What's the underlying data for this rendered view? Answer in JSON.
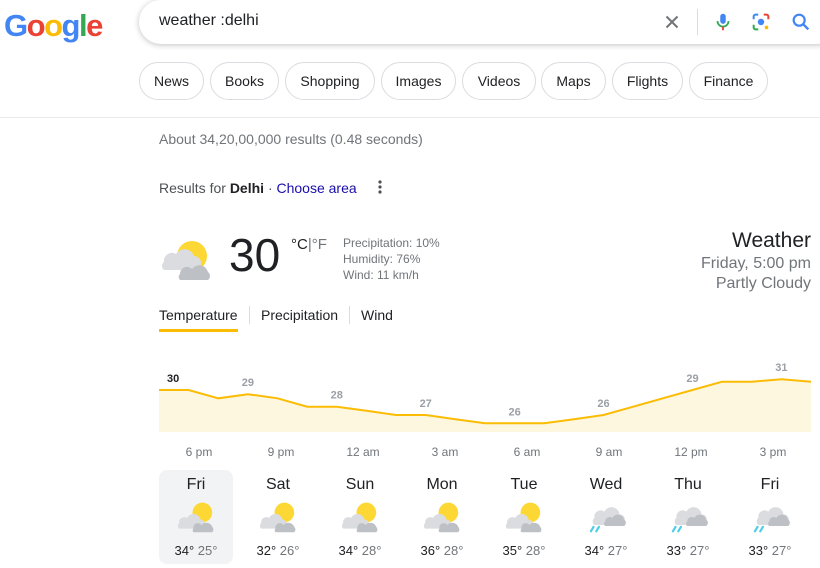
{
  "logo": {
    "text": "Google",
    "letters": [
      "G",
      "o",
      "o",
      "g",
      "l",
      "e"
    ]
  },
  "search": {
    "query": "weather :delhi"
  },
  "chips": [
    "News",
    "Books",
    "Shopping",
    "Images",
    "Videos",
    "Maps",
    "Flights",
    "Finance"
  ],
  "stats": "About 34,20,00,000 results (0.48 seconds)",
  "results_for": {
    "prefix": "Results for",
    "place": "Delhi",
    "separator": "·",
    "change_link": "Choose area"
  },
  "current": {
    "temp": "30",
    "unit_c": "°C",
    "unit_sep": "|",
    "unit_f": "°F",
    "precipitation": "Precipitation: 10%",
    "humidity": "Humidity: 76%",
    "wind": "Wind: 11 km/h",
    "icon": "partly-cloudy-icon"
  },
  "header": {
    "title": "Weather",
    "time": "Friday, 5:00 pm",
    "condition": "Partly Cloudy"
  },
  "tabs": [
    "Temperature",
    "Precipitation",
    "Wind"
  ],
  "colors": {
    "accent": "#fbbc04",
    "chart_fill": "#fef7e0",
    "link": "#1a0dab",
    "rain": "#4ecde6"
  },
  "chart_data": {
    "type": "area",
    "values": [
      30,
      30,
      29,
      29.5,
      29,
      28,
      28,
      27.5,
      27,
      27,
      26.5,
      26,
      26,
      26,
      26.5,
      27,
      28,
      29,
      30,
      31,
      31,
      31.3,
      31
    ],
    "labels": [
      {
        "text": "30",
        "index": 0
      },
      {
        "text": "29",
        "index": 3
      },
      {
        "text": "28",
        "index": 6
      },
      {
        "text": "27",
        "index": 9
      },
      {
        "text": "26",
        "index": 12
      },
      {
        "text": "26",
        "index": 15
      },
      {
        "text": "29",
        "index": 18
      },
      {
        "text": "31",
        "index": 21
      }
    ],
    "ylim": [
      24,
      33
    ],
    "x_ticks": [
      "6 pm",
      "9 pm",
      "12 am",
      "3 am",
      "6 am",
      "9 am",
      "12 pm",
      "3 pm"
    ]
  },
  "days": [
    {
      "name": "Fri",
      "hi": "34°",
      "lo": "25°",
      "icon": "partly-cloudy-icon",
      "selected": true
    },
    {
      "name": "Sat",
      "hi": "32°",
      "lo": "26°",
      "icon": "partly-cloudy-icon"
    },
    {
      "name": "Sun",
      "hi": "34°",
      "lo": "28°",
      "icon": "partly-cloudy-icon"
    },
    {
      "name": "Mon",
      "hi": "36°",
      "lo": "28°",
      "icon": "partly-cloudy-icon"
    },
    {
      "name": "Tue",
      "hi": "35°",
      "lo": "28°",
      "icon": "partly-cloudy-icon"
    },
    {
      "name": "Wed",
      "hi": "34°",
      "lo": "27°",
      "icon": "rain-icon"
    },
    {
      "name": "Thu",
      "hi": "33°",
      "lo": "27°",
      "icon": "rain-icon"
    },
    {
      "name": "Fri",
      "hi": "33°",
      "lo": "27°",
      "icon": "rain-icon"
    }
  ]
}
